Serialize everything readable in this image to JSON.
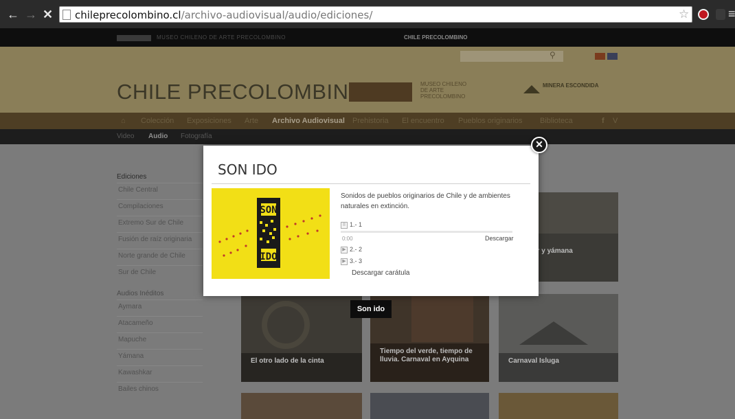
{
  "browser": {
    "url_domain": "chileprecolombino.cl",
    "url_path": "/archivo-audiovisual/audio/ediciones/"
  },
  "site": {
    "title": "CHILE PRECOLOMBINO",
    "top_strip_link": "CHILE PRECOLOMBINO",
    "museum_name": "MUSEO CHILENO DE ARTE PRECOLOMBINO",
    "sponsor": "MINERA ESCONDIDA"
  },
  "main_nav": [
    {
      "label": "Colección"
    },
    {
      "label": "Exposiciones"
    },
    {
      "label": "Arte"
    },
    {
      "label": "Archivo Audiovisual"
    },
    {
      "label": "Prehistoria"
    },
    {
      "label": "El encuentro"
    },
    {
      "label": "Pueblos originarios"
    },
    {
      "label": "Biblioteca"
    }
  ],
  "sub_nav": [
    {
      "label": "Video"
    },
    {
      "label": "Audio"
    },
    {
      "label": "Fotografía"
    }
  ],
  "sidebar": {
    "ediciones_heading": "Ediciones",
    "ediciones": [
      {
        "label": "Chile Central"
      },
      {
        "label": "Compilaciones"
      },
      {
        "label": "Extremo Sur de Chile"
      },
      {
        "label": "Fusión de raíz originaria"
      },
      {
        "label": "Norte grande de Chile"
      },
      {
        "label": "Sur de Chile"
      }
    ],
    "ineditos_heading": "Audios Inéditos",
    "ineditos": [
      {
        "label": "Aymara"
      },
      {
        "label": "Atacameño"
      },
      {
        "label": "Mapuche"
      },
      {
        "label": "Yámana"
      },
      {
        "label": "Kawashkar"
      },
      {
        "label": "Bailes chinos"
      }
    ]
  },
  "grid": {
    "hover_tag": "Son ido",
    "partial_caption": "ar y yámana",
    "cards": [
      {
        "caption": "El otro lado de la cinta"
      },
      {
        "caption": "Tiempo del verde, tiempo de lluvia. Carnaval en Ayquina"
      },
      {
        "caption": "Carnaval Isluga"
      }
    ]
  },
  "modal": {
    "title": "SON IDO",
    "description": "Sonidos de pueblos originarios de Chile y de ambientes naturales en extinción.",
    "tracks": [
      {
        "label": "1.- 1"
      },
      {
        "label": "2.- 2"
      },
      {
        "label": "3.- 3"
      }
    ],
    "time": "0:00",
    "download_label": "Descargar",
    "download_cover_label": "Descargar carátula",
    "cover_text": [
      "SON",
      "IDO"
    ],
    "close_symbol": "✕"
  }
}
